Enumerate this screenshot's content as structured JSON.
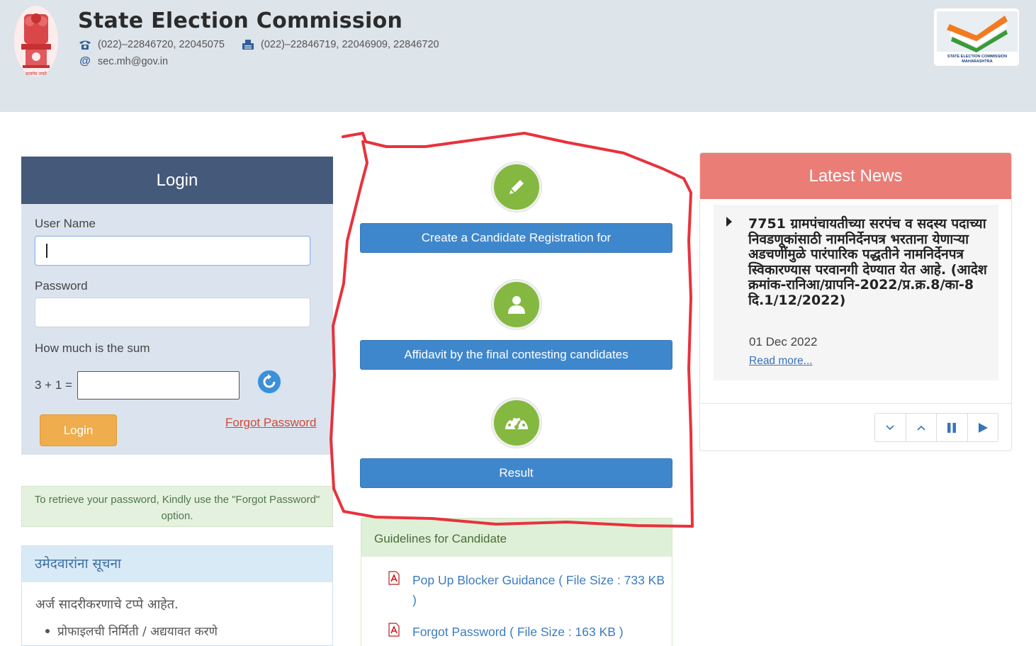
{
  "header": {
    "title": "State Election Commission",
    "phone": "(022)–22846720, 22045075",
    "fax": "(022)–22846719, 22046909, 22846720",
    "email": "sec.mh@gov.in",
    "emblem_caption": "सत्यमेव जयते",
    "logo_text_line1": "STATE ELECTION COMMISSION",
    "logo_text_line2": "MAHARASHTRA"
  },
  "login": {
    "heading": "Login",
    "username_label": "User Name",
    "username_value": "",
    "password_label": "Password",
    "password_value": "",
    "captcha_question": "How much is the sum",
    "captcha_expression": "3 + 1 =",
    "captcha_value": "",
    "login_button": "Login",
    "forgot_link": "Forgot Password"
  },
  "info_message": "To retrieve your password, Kindly use the \"Forgot Password\" option.",
  "notice": {
    "heading": "उमेदवारांना सूचना",
    "line": "अर्ज सादरीकरणाचे टप्पे आहेत.",
    "bullets": [
      "प्रोफाइलची निर्मिती / अद्ययावत करणे"
    ]
  },
  "actions": [
    {
      "label": "Create a Candidate Registration for",
      "icon": "pencil-icon"
    },
    {
      "label": "Affidavit by the final contesting candidates",
      "icon": "user-icon"
    },
    {
      "label": "Result",
      "icon": "speedometer-icon"
    }
  ],
  "guidelines": {
    "heading": "Guidelines for Candidate",
    "items": [
      {
        "label": "Pop Up Blocker Guidance ( File Size : 733 KB )"
      },
      {
        "label": "Forgot Password ( File Size : 163 KB )"
      }
    ]
  },
  "news": {
    "heading": "Latest News",
    "title": "7751 ग्रामपंचायतीच्या सरपंच व सदस्य पदाच्या निवडणूकांसाठी नामनिर्देनपत्र भरताना येणाऱ्या अडचणींमुळे पारंपारिक पद्धतीने नामनिर्देनपत्र स्विकारण्यास परवानगी देण्यात येत आहे. (आदेश क्रमांक-रानिआ/ग्रापनि-2022/प्र.क्र.8/का-8 दि.1/12/2022)",
    "date": "01 Dec 2022",
    "read_more": "Read more..."
  },
  "colors": {
    "header_bg": "#dde4ea",
    "login_head": "#45597a",
    "action_blue": "#3f87cc",
    "icon_green": "#84b840",
    "news_head": "#eb7d77",
    "annotation_red": "#e8323c"
  }
}
